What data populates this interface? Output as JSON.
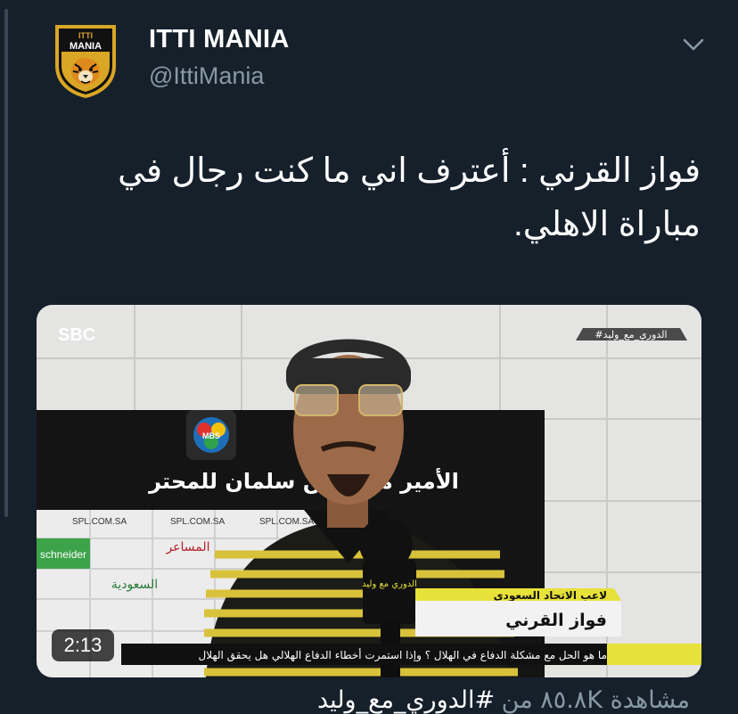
{
  "account": {
    "display_name": "ITTI MANIA",
    "handle": "@IttiMania",
    "logo_text_top": "ITTI",
    "logo_text_main": "MANIA"
  },
  "tweet": {
    "text": "فواز القرني : أعترف اني ما كنت رجال في مباراة الاهلي.",
    "video_duration": "2:13",
    "views_line": "مشاهدة ٨٥.٨K من",
    "hashtag": "#الدوري_مع_وليد"
  },
  "video_frame": {
    "channel_logo": "SBC",
    "show_tag": "#الدوري_مع_وليد",
    "backdrop_title": "الأمير محمد بن سلمان للمحتر",
    "sponsor_url": "SPL.COM.SA",
    "sponsor_1": "schneider",
    "sponsor_2": "السعودية",
    "sponsor_3": "المساعر",
    "league_badge": "MBS",
    "mic_label": "الدوري مع وليد",
    "lower_third_role": "لاعب الاتحاد السعودي",
    "lower_third_name": "فواز القرني",
    "ticker": "ما هو الحل مع مشكلة الدفاع في الهلال ؟ وإذا استمرت أخطاء الدفاع الهلالي هل يحقق الهلال"
  },
  "colors": {
    "background": "#15202b",
    "text_primary": "#ffffff",
    "text_secondary": "#8899a6",
    "logo_gold": "#d9a626",
    "shirt_yellow": "#d8c23a"
  }
}
